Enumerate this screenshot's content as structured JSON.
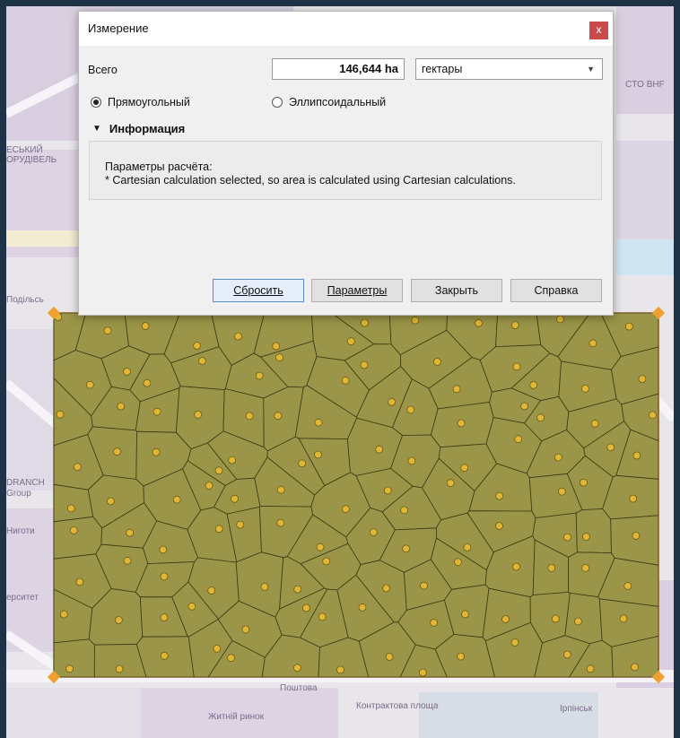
{
  "dialog": {
    "title": "Измерение",
    "close_glyph": "x",
    "total_label": "Всего",
    "total_value": "146,644 ha",
    "unit_selected": "гектары",
    "radio_cartesian": "Прямоугольный",
    "radio_ellipsoidal": "Эллипсоидальный",
    "cartesian_selected": true,
    "info_header": "Информация",
    "info_line1": "Параметры расчёта:",
    "info_line2": "* Cartesian calculation selected, so area is calculated using Cartesian calculations.",
    "buttons": {
      "reset": "Сбросить",
      "params": "Параметры",
      "close": "Закрыть",
      "help": "Справка"
    }
  },
  "map": {
    "labels": {
      "l1": "ЕСЬКИЙ",
      "l2": "ОРУДІВЕЛЬ",
      "l3": "Подільсь",
      "l4": "Ниготи",
      "l5": "ерситет",
      "l6": "DRANCH",
      "l7": "Group",
      "l8": "Контрактова площа",
      "l9": "Житній ринок",
      "l10": "Поштова",
      "l11": "Ірпінськ",
      "l12": "CTO BHF"
    },
    "polygon_fill": "#9a9549",
    "edge_color": "#3d3a12",
    "point_color": "#e0b636",
    "vertex_color": "#f0a030"
  }
}
